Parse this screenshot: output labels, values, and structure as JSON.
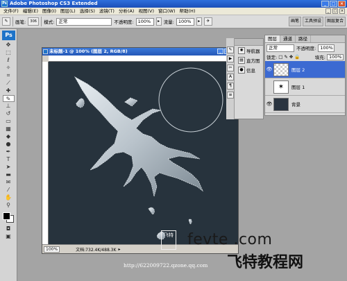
{
  "app": {
    "title": "Adobe Photoshop CS3 Extended",
    "icon_label": "Ps"
  },
  "window_buttons": [
    "_",
    "□",
    "×"
  ],
  "menubar": {
    "items": [
      "文件(F)",
      "编辑(E)",
      "图像(I)",
      "图层(L)",
      "选择(S)",
      "滤镜(T)",
      "分析(A)",
      "视图(V)",
      "窗口(W)",
      "帮助(H)"
    ]
  },
  "options": {
    "brush_label": "画笔:",
    "brush_size": "306",
    "mode_label": "模式:",
    "mode_value": "正常",
    "opacity_label": "不透明度:",
    "opacity_value": "100%",
    "flow_label": "流量:",
    "flow_value": "100%"
  },
  "well": [
    "画笔",
    "工具预设",
    "图层复合"
  ],
  "toolbox": {
    "logo": "Ps",
    "tools": [
      "move-tool",
      "marquee-tool",
      "lasso-tool",
      "magic-wand-tool",
      "crop-tool",
      "slice-tool",
      "healing-brush-tool",
      "brush-tool",
      "clone-stamp-tool",
      "history-brush-tool",
      "eraser-tool",
      "gradient-tool",
      "blur-tool",
      "dodge-tool",
      "pen-tool",
      "type-tool",
      "path-selection-tool",
      "shape-tool",
      "notes-tool",
      "eyedropper-tool",
      "hand-tool",
      "zoom-tool"
    ],
    "foreground_color": "#000000",
    "background_color": "#ffffff"
  },
  "document": {
    "title": "未标题-1 @ 100% (图层 2, RGB/8)",
    "zoom": "100%",
    "status": "文档:732.4K/488.3K",
    "canvas_color": "#27333d"
  },
  "nav_panel": {
    "items": [
      {
        "label": "导航器",
        "icon": "navigator-icon"
      },
      {
        "label": "直方图",
        "icon": "histogram-icon"
      },
      {
        "label": "信息",
        "icon": "info-icon"
      }
    ]
  },
  "layers_panel": {
    "tabs": [
      "图层",
      "通道",
      "路径"
    ],
    "blend_mode": "正常",
    "opacity_label": "不透明度:",
    "opacity_value": "100%",
    "lock_label": "锁定:",
    "fill_label": "填充:",
    "fill_value": "100%",
    "layers": [
      {
        "name": "图层 2",
        "selected": true,
        "thumb": "transparent"
      },
      {
        "name": "图层 1",
        "selected": false,
        "thumb": "splash"
      },
      {
        "name": "背景",
        "selected": false,
        "thumb": "dark"
      }
    ]
  },
  "watermark": {
    "line1": "fevte .com",
    "line2": "飞特教程网",
    "url": "http://622009722.qzone.qq.com",
    "stamp": "飞特"
  }
}
